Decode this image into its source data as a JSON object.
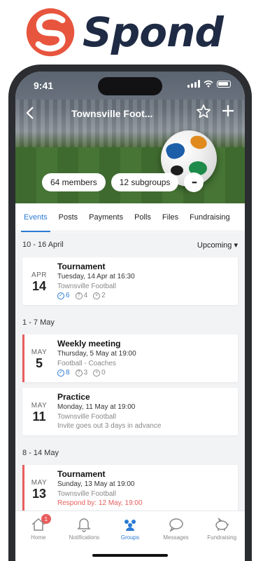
{
  "brand": {
    "name": "Spond",
    "color": "#e8553e"
  },
  "status": {
    "time": "9:41"
  },
  "header": {
    "title": "Townsville Foot...",
    "members": "64 members",
    "subgroups": "12 subgroups",
    "more": "•••"
  },
  "tabs": [
    {
      "label": "Events",
      "active": true
    },
    {
      "label": "Posts"
    },
    {
      "label": "Payments"
    },
    {
      "label": "Polls"
    },
    {
      "label": "Files"
    },
    {
      "label": "Fundraising"
    }
  ],
  "filter": {
    "label": "Upcoming ▾"
  },
  "sections": [
    {
      "range": "10 - 16 April",
      "events": [
        {
          "month": "APR",
          "day": "14",
          "title": "Tournament",
          "time": "Tuesday, 14 Apr at 16:30",
          "group": "Townsville Football",
          "accepted": "6",
          "pending": "4",
          "declined": "2"
        }
      ]
    },
    {
      "range": "1 - 7 May",
      "events": [
        {
          "month": "MAY",
          "day": "5",
          "title": "Weekly meeting",
          "time": "Thursday, 5 May at 19:00",
          "group": "Football - Coaches",
          "accepted": "8",
          "pending": "3",
          "declined": "0"
        },
        {
          "month": "MAY",
          "day": "11",
          "title": "Practice",
          "time": "Monday, 11 May at 19:00",
          "group": "Townsville Football",
          "note": "Invite goes out 3 days in advance"
        }
      ]
    },
    {
      "range": "8 - 14 May",
      "events": [
        {
          "month": "MAY",
          "day": "13",
          "title": "Tournament",
          "time": "Sunday, 13 May at 19:00",
          "group": "Townsville Football",
          "note": "Respond by: 12 May, 19:00"
        }
      ]
    }
  ],
  "tabbar": [
    {
      "label": "Home",
      "badge": "1"
    },
    {
      "label": "Notifications"
    },
    {
      "label": "Groups",
      "active": true
    },
    {
      "label": "Messages"
    },
    {
      "label": "Fundraising"
    }
  ]
}
